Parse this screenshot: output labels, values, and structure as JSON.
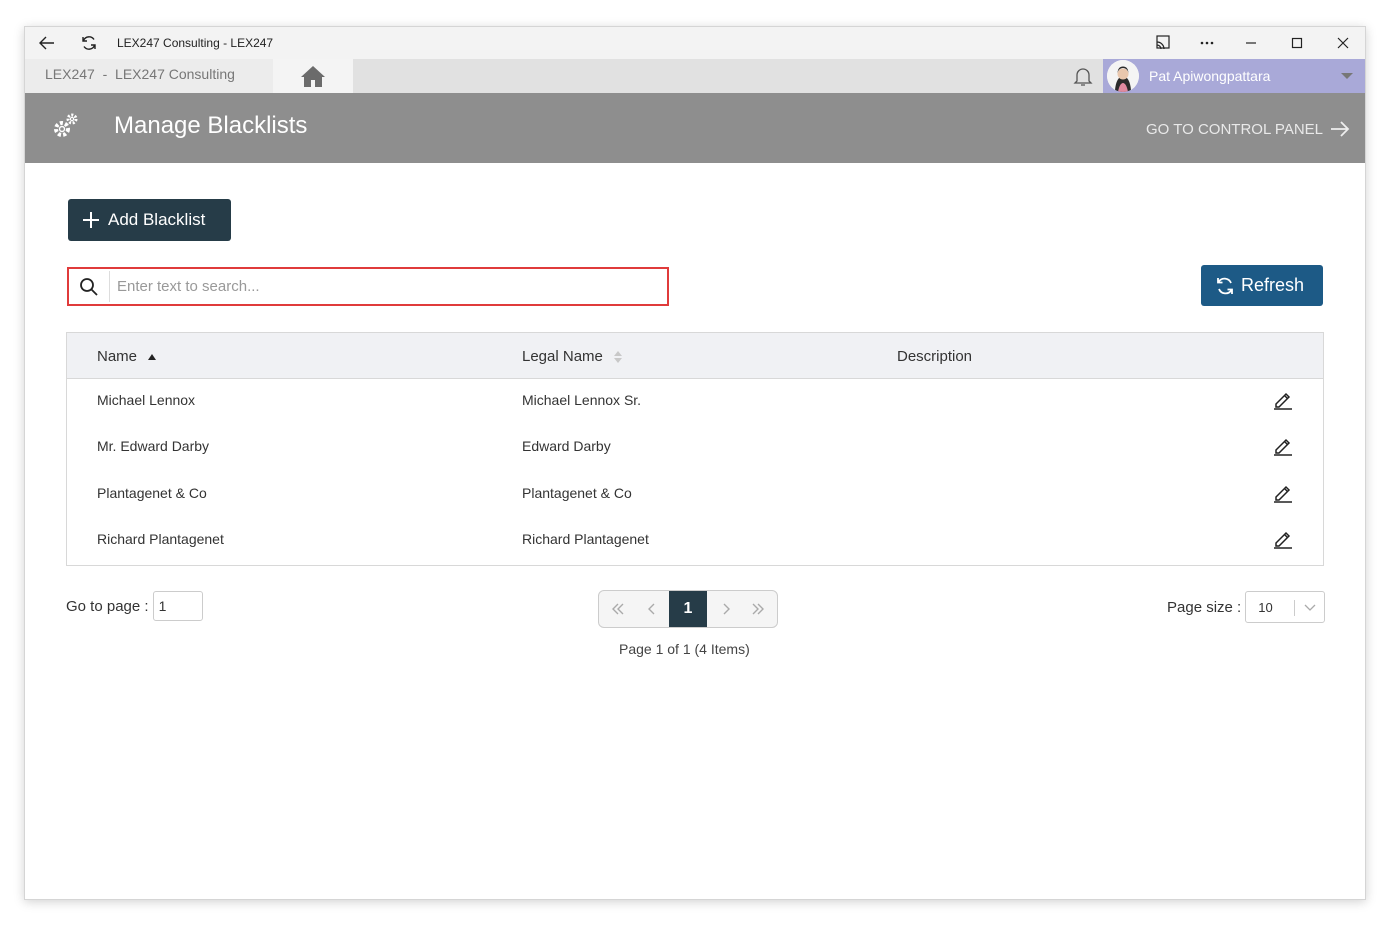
{
  "window": {
    "title": "LEX247 Consulting - LEX247"
  },
  "appbar": {
    "breadcrumb": "LEX247  -  LEX247 Consulting",
    "user_name": "Pat Apiwongpattara"
  },
  "header": {
    "title": "Manage Blacklists",
    "control_panel_link": "GO TO CONTROL PANEL"
  },
  "toolbar": {
    "add_label": "Add Blacklist",
    "refresh_label": "Refresh"
  },
  "search": {
    "placeholder": "Enter text to search..."
  },
  "grid": {
    "columns": [
      "Name",
      "Legal Name",
      "Description"
    ],
    "rows": [
      {
        "name": "Michael Lennox",
        "legal_name": "Michael Lennox Sr.",
        "description": ""
      },
      {
        "name": "Mr. Edward Darby",
        "legal_name": "Edward Darby",
        "description": ""
      },
      {
        "name": "Plantagenet & Co",
        "legal_name": "Plantagenet & Co",
        "description": ""
      },
      {
        "name": "Richard Plantagenet",
        "legal_name": "Richard Plantagenet",
        "description": ""
      }
    ]
  },
  "pager": {
    "goto_label": "Go to page :",
    "goto_value": "1",
    "current_page": "1",
    "info": "Page 1 of 1 (4 Items)",
    "page_size_label": "Page size :",
    "page_size_value": "10"
  },
  "colors": {
    "header_bg": "#8e8e8e",
    "primary_dark": "#263c48",
    "refresh_blue": "#1d5a86",
    "search_border": "#e03b3b",
    "user_bg": "#a9a9d8"
  }
}
